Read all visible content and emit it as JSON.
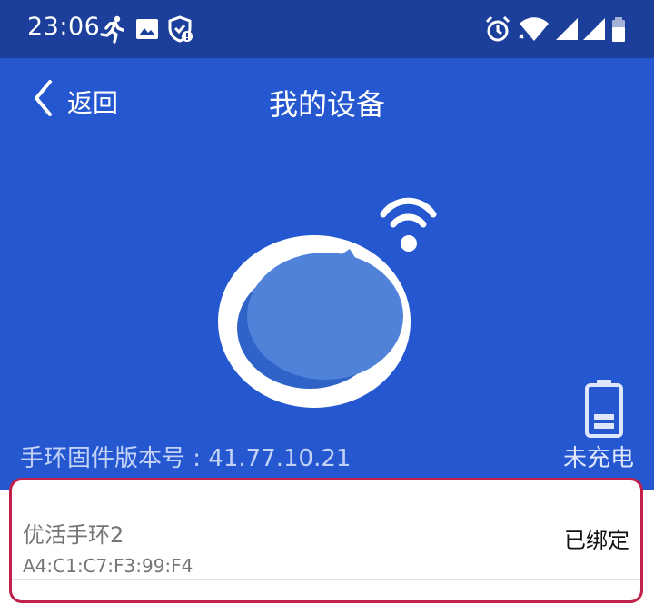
{
  "status_bar": {
    "time": "23:06",
    "left_icons": [
      "running-icon",
      "image-icon",
      "shield-icon"
    ],
    "right_icons": [
      "alarm-icon",
      "wifi-icon",
      "signal-icon",
      "signal-icon",
      "battery-icon"
    ]
  },
  "header": {
    "back_label": "返回",
    "title": "我的设备"
  },
  "device": {
    "firmware_text": "手环固件版本号 : 41.77.10.21",
    "charge_status": "未充电",
    "name": "优活手环2",
    "mac": "A4:C1:C7:F3:99:F4",
    "bind_status": "已绑定"
  },
  "colors": {
    "status_bar_bg": "#1b3f9a",
    "hero_bg": "#2457d0",
    "card_border": "#c0204a"
  }
}
